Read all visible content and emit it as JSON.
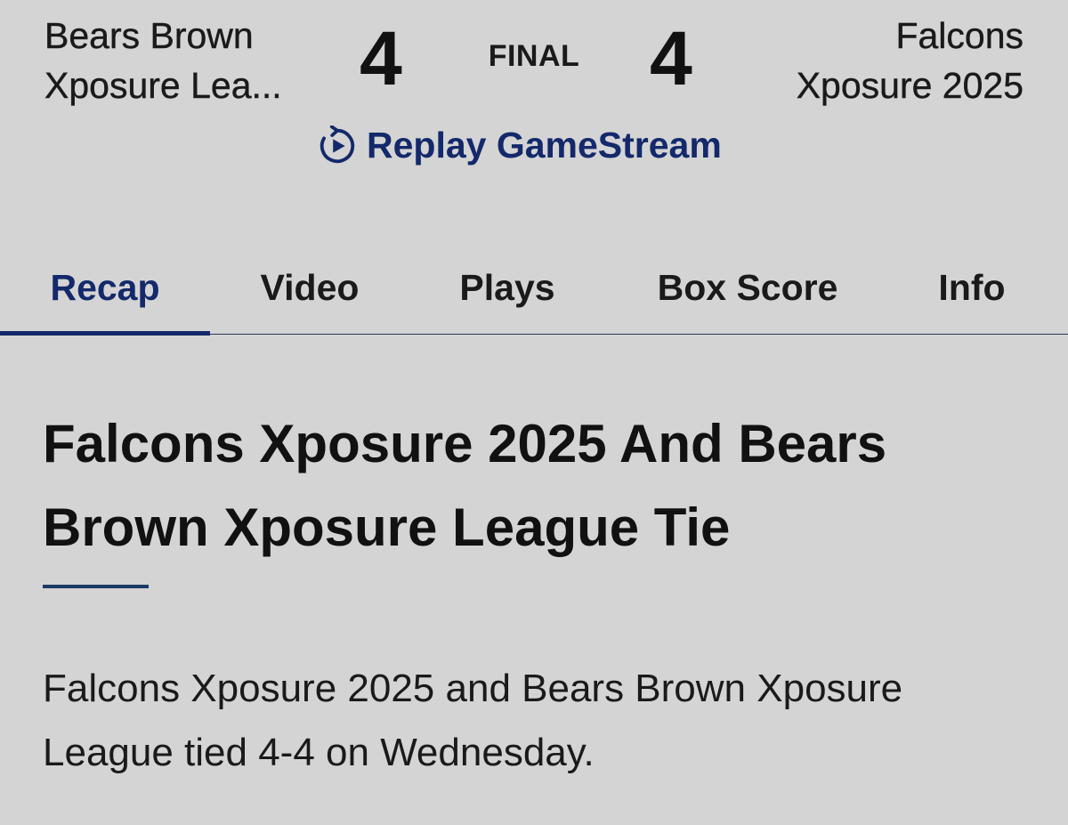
{
  "scoreboard": {
    "away_team": {
      "line1": "Bears Brown",
      "line2": "Xposure Lea..."
    },
    "away_score": "4",
    "status": "FINAL",
    "home_score": "4",
    "home_team": {
      "line1": "Falcons",
      "line2": "Xposure 2025"
    },
    "replay_label": "Replay GameStream",
    "replay_icon": "replay-play-icon"
  },
  "tabs": [
    {
      "label": "Recap",
      "active": true
    },
    {
      "label": "Video",
      "active": false
    },
    {
      "label": "Plays",
      "active": false
    },
    {
      "label": "Box Score",
      "active": false
    },
    {
      "label": "Info",
      "active": false
    }
  ],
  "article": {
    "headline": "Falcons Xposure 2025 And Bears Brown Xposure League Tie",
    "summary": "Falcons Xposure 2025 and Bears Brown Xposure League tied 4-4 on Wednesday."
  },
  "colors": {
    "background": "#d4d4d4",
    "accent": "#14296b",
    "text": "#111111"
  }
}
